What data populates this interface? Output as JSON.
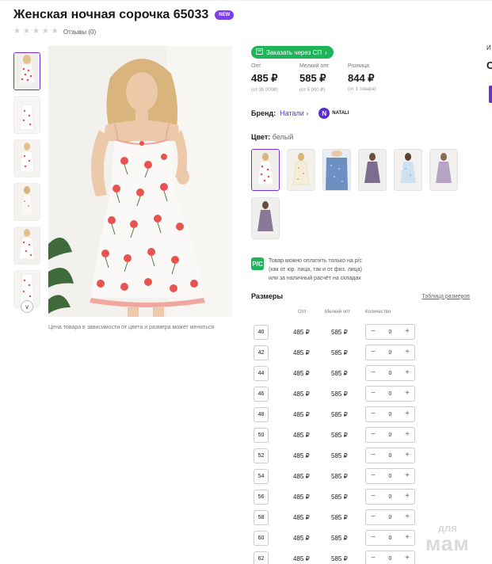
{
  "product": {
    "title": "Женская ночная сорочка 65033",
    "badge": "NEW",
    "reviews_label": "Отзывы (0)",
    "rating": 0,
    "price_note": "Цена товара в зависимости от цвета и размера может меняться"
  },
  "sp_button": {
    "label": "Заказать через СП"
  },
  "prices": [
    {
      "label": "Опт",
      "value": "485 ₽",
      "sub": "(от 35 000₽)"
    },
    {
      "label": "Мелкий опт",
      "value": "585 ₽",
      "sub": "(от 5 000 ₽)"
    },
    {
      "label": "Розница",
      "value": "844 ₽",
      "sub": "(от 1 товара)"
    }
  ],
  "brand": {
    "label": "Бренд:",
    "name": "Натали",
    "logo_text": "NATALI",
    "logo_letter": "N"
  },
  "color": {
    "label": "Цвет:",
    "value": "белый"
  },
  "payment_note": {
    "icon": "P/C",
    "line1": "Товар можно оплатить только на р/с",
    "line2": "(как от юр. лица, так и от физ. лица)",
    "line3": "или за наличный расчёт на складах"
  },
  "sizes": {
    "title": "Размеры",
    "table_link": "Таблица размеров",
    "col_opt": "Опт",
    "col_small": "Мелкий опт",
    "col_qty": "Количество",
    "rows": [
      {
        "size": "40",
        "opt": "485 ₽",
        "small": "585 ₽",
        "qty": "0"
      },
      {
        "size": "42",
        "opt": "485 ₽",
        "small": "585 ₽",
        "qty": "0"
      },
      {
        "size": "44",
        "opt": "485 ₽",
        "small": "585 ₽",
        "qty": "0"
      },
      {
        "size": "46",
        "opt": "485 ₽",
        "small": "585 ₽",
        "qty": "0"
      },
      {
        "size": "48",
        "opt": "485 ₽",
        "small": "585 ₽",
        "qty": "0"
      },
      {
        "size": "50",
        "opt": "485 ₽",
        "small": "585 ₽",
        "qty": "0"
      },
      {
        "size": "52",
        "opt": "485 ₽",
        "small": "585 ₽",
        "qty": "0"
      },
      {
        "size": "54",
        "opt": "485 ₽",
        "small": "585 ₽",
        "qty": "0"
      },
      {
        "size": "56",
        "opt": "485 ₽",
        "small": "585 ₽",
        "qty": "0"
      },
      {
        "size": "58",
        "opt": "485 ₽",
        "small": "585 ₽",
        "qty": "0"
      },
      {
        "size": "60",
        "opt": "485 ₽",
        "small": "585 ₽",
        "qty": "0"
      },
      {
        "size": "62",
        "opt": "485 ₽",
        "small": "585 ₽",
        "qty": "0"
      }
    ]
  },
  "right_edge": {
    "text1": "И",
    "text2": "С"
  },
  "watermark": {
    "line1": "для",
    "line2": "мам"
  },
  "colors": {
    "accent": "#6e2fd6",
    "green": "#1fb35a",
    "link": "#4a3fc4"
  }
}
